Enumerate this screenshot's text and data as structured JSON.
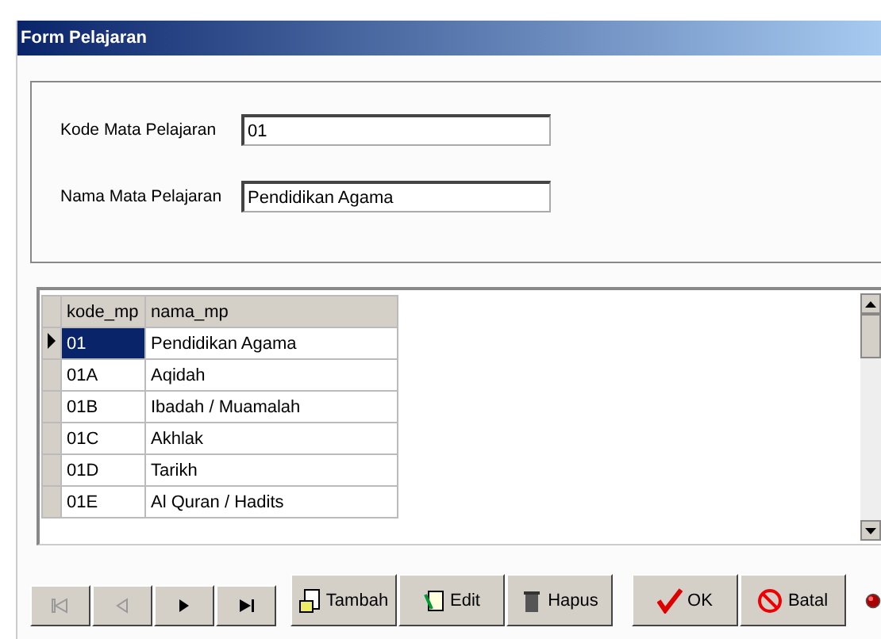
{
  "window": {
    "title": "Form Pelajaran"
  },
  "fields": [
    {
      "label": "Kode Mata Pelajaran",
      "value": "01"
    },
    {
      "label": "Nama Mata Pelajaran",
      "value": "Pendidikan Agama"
    }
  ],
  "table": {
    "columns": [
      "kode_mp",
      "nama_mp"
    ],
    "rows": [
      {
        "cells": [
          "01",
          "Pendidikan Agama"
        ],
        "selected": true
      },
      {
        "cells": [
          "01A",
          "Aqidah"
        ],
        "selected": false
      },
      {
        "cells": [
          "01B",
          "Ibadah / Muamalah"
        ],
        "selected": false
      },
      {
        "cells": [
          "01C",
          "Akhlak"
        ],
        "selected": false
      },
      {
        "cells": [
          "01D",
          "Tarikh"
        ],
        "selected": false
      },
      {
        "cells": [
          "01E",
          "Al Quran / Hadits"
        ],
        "selected": false
      }
    ]
  },
  "navigator": [
    {
      "kind": "first",
      "disabled": true
    },
    {
      "kind": "prev",
      "disabled": true
    },
    {
      "kind": "next",
      "disabled": false
    },
    {
      "kind": "last",
      "disabled": false
    }
  ],
  "actions": [
    {
      "kind": "add",
      "label": "Tambah"
    },
    {
      "kind": "edit",
      "label": "Edit"
    },
    {
      "kind": "delete",
      "label": "Hapus"
    }
  ],
  "confirm": [
    {
      "kind": "ok",
      "label": "OK"
    },
    {
      "kind": "cancel",
      "label": "Batal"
    }
  ]
}
